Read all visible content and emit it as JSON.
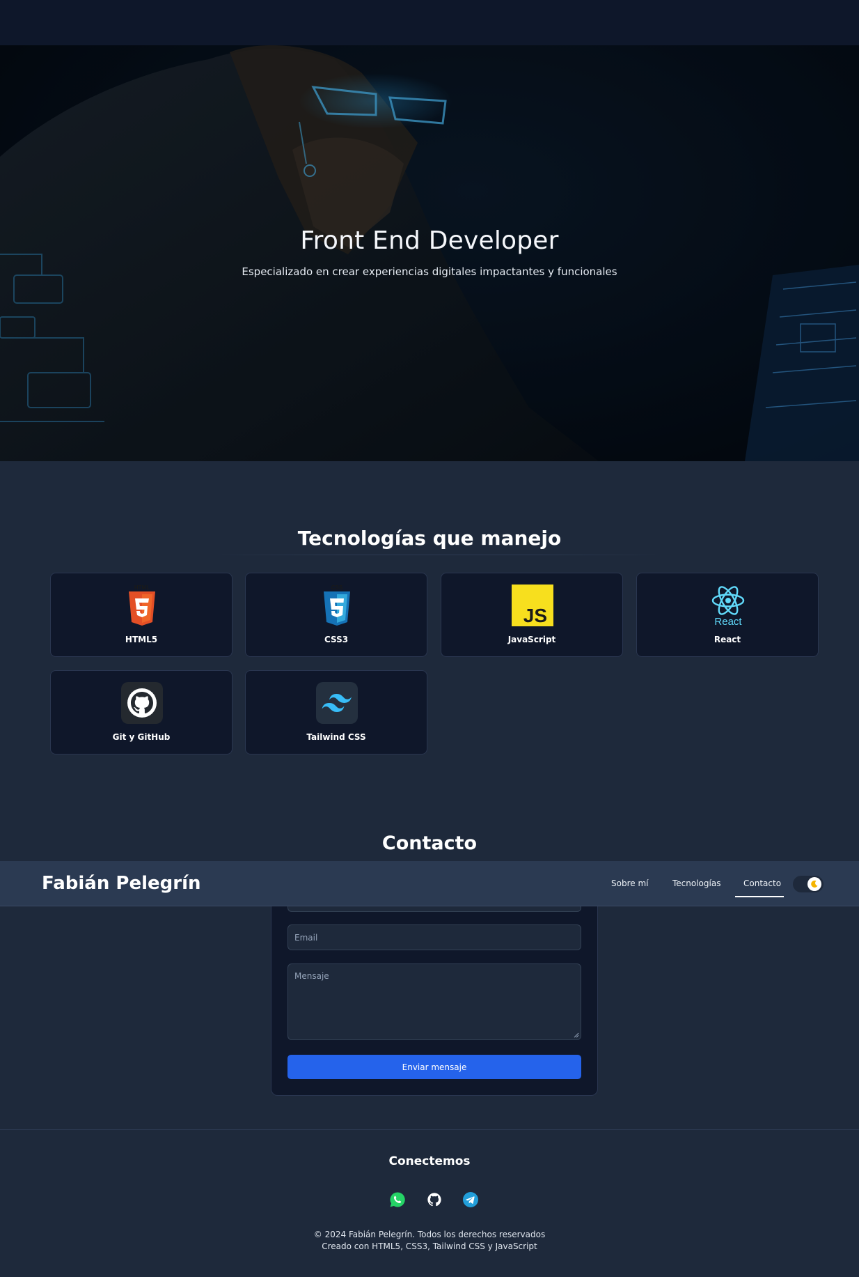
{
  "hero": {
    "title": "Front End Developer",
    "subtitle": "Especializado en crear experiencias digitales impactantes y funcionales"
  },
  "technologies": {
    "title": "Tecnologías que manejo",
    "items": [
      {
        "label": "HTML5",
        "icon": "html5-icon",
        "color": "#e34f26"
      },
      {
        "label": "CSS3",
        "icon": "css3-icon",
        "color": "#1572b6"
      },
      {
        "label": "JavaScript",
        "icon": "javascript-icon",
        "color": "#f7df1e"
      },
      {
        "label": "React",
        "icon": "react-icon",
        "color": "#61dafb"
      },
      {
        "label": "Git y GitHub",
        "icon": "github-icon",
        "color": "#ffffff"
      },
      {
        "label": "Tailwind CSS",
        "icon": "tailwind-icon",
        "color": "#38bdf8"
      }
    ]
  },
  "contact": {
    "title": "Contacto",
    "email_placeholder": "Email",
    "message_placeholder": "Mensaje",
    "submit_label": "Enviar mensaje"
  },
  "navbar": {
    "brand": "Fabián Pelegrín",
    "links": [
      "Sobre mí",
      "Tecnologías",
      "Contacto"
    ],
    "active": "Contacto",
    "theme_toggle_icon": "moon-icon"
  },
  "footer": {
    "title": "Conectemos",
    "socials": [
      {
        "icon": "whatsapp-icon",
        "color": "#25d366"
      },
      {
        "icon": "github-icon",
        "color": "#ffffff"
      },
      {
        "icon": "telegram-icon",
        "color": "#229ed9"
      }
    ],
    "copyright": "© 2024 Fabián Pelegrín. Todos los derechos reservados",
    "made_with": "Creado con HTML5, CSS3, Tailwind CSS y JavaScript"
  },
  "colors": {
    "background": "#1e293b",
    "card": "#0f172a",
    "accent": "#2563eb",
    "navbar": "#2b3a52"
  }
}
